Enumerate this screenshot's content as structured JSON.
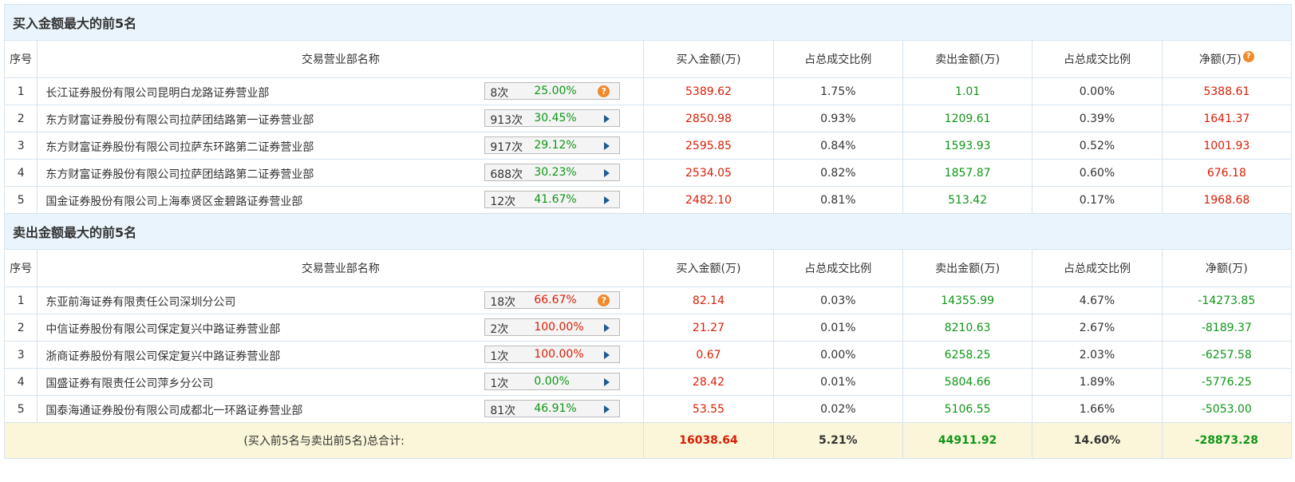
{
  "buy_section": {
    "title": "买入金额最大的前5名",
    "headers": [
      "序号",
      "交易营业部名称",
      "买入金额(万)",
      "占总成交比例",
      "卖出金额(万)",
      "占总成交比例",
      "净额(万)"
    ],
    "rows": [
      {
        "idx": "1",
        "name": "长江证券股份有限公司昆明白龙路证券营业部",
        "count": "8次",
        "pct": "25.00%",
        "pct_color": "green",
        "icon": "question-icon",
        "buy": "5389.62",
        "buy_ratio": "1.75%",
        "sell": "1.01",
        "sell_ratio": "0.00%",
        "net": "5388.61",
        "net_color": "red"
      },
      {
        "idx": "2",
        "name": "东方财富证券股份有限公司拉萨团结路第一证券营业部",
        "count": "913次",
        "pct": "30.45%",
        "pct_color": "green",
        "icon": "arrow-right-icon",
        "buy": "2850.98",
        "buy_ratio": "0.93%",
        "sell": "1209.61",
        "sell_ratio": "0.39%",
        "net": "1641.37",
        "net_color": "red"
      },
      {
        "idx": "3",
        "name": "东方财富证券股份有限公司拉萨东环路第二证券营业部",
        "count": "917次",
        "pct": "29.12%",
        "pct_color": "green",
        "icon": "arrow-right-icon",
        "buy": "2595.85",
        "buy_ratio": "0.84%",
        "sell": "1593.93",
        "sell_ratio": "0.52%",
        "net": "1001.93",
        "net_color": "red"
      },
      {
        "idx": "4",
        "name": "东方财富证券股份有限公司拉萨团结路第二证券营业部",
        "count": "688次",
        "pct": "30.23%",
        "pct_color": "green",
        "icon": "arrow-right-icon",
        "buy": "2534.05",
        "buy_ratio": "0.82%",
        "sell": "1857.87",
        "sell_ratio": "0.60%",
        "net": "676.18",
        "net_color": "red"
      },
      {
        "idx": "5",
        "name": "国金证券股份有限公司上海奉贤区金碧路证券营业部",
        "count": "12次",
        "pct": "41.67%",
        "pct_color": "green",
        "icon": "arrow-right-icon",
        "buy": "2482.10",
        "buy_ratio": "0.81%",
        "sell": "513.42",
        "sell_ratio": "0.17%",
        "net": "1968.68",
        "net_color": "red"
      }
    ]
  },
  "sell_section": {
    "title": "卖出金额最大的前5名",
    "headers": [
      "序号",
      "交易营业部名称",
      "买入金额(万)",
      "占总成交比例",
      "卖出金额(万)",
      "占总成交比例",
      "净额(万)"
    ],
    "rows": [
      {
        "idx": "1",
        "name": "东亚前海证券有限责任公司深圳分公司",
        "count": "18次",
        "pct": "66.67%",
        "pct_color": "red",
        "icon": "question-icon",
        "buy": "82.14",
        "buy_ratio": "0.03%",
        "sell": "14355.99",
        "sell_ratio": "4.67%",
        "net": "-14273.85",
        "net_color": "green"
      },
      {
        "idx": "2",
        "name": "中信证券股份有限公司保定复兴中路证券营业部",
        "count": "2次",
        "pct": "100.00%",
        "pct_color": "red",
        "icon": "arrow-right-icon",
        "buy": "21.27",
        "buy_ratio": "0.01%",
        "sell": "8210.63",
        "sell_ratio": "2.67%",
        "net": "-8189.37",
        "net_color": "green"
      },
      {
        "idx": "3",
        "name": "浙商证券股份有限公司保定复兴中路证券营业部",
        "count": "1次",
        "pct": "100.00%",
        "pct_color": "red",
        "icon": "arrow-right-icon",
        "buy": "0.67",
        "buy_ratio": "0.00%",
        "sell": "6258.25",
        "sell_ratio": "2.03%",
        "net": "-6257.58",
        "net_color": "green"
      },
      {
        "idx": "4",
        "name": "国盛证券有限责任公司萍乡分公司",
        "count": "1次",
        "pct": "0.00%",
        "pct_color": "green",
        "icon": "arrow-right-icon",
        "buy": "28.42",
        "buy_ratio": "0.01%",
        "sell": "5804.66",
        "sell_ratio": "1.89%",
        "net": "-5776.25",
        "net_color": "green"
      },
      {
        "idx": "5",
        "name": "国泰海通证券股份有限公司成都北一环路证券营业部",
        "count": "81次",
        "pct": "46.91%",
        "pct_color": "green",
        "icon": "arrow-right-icon",
        "buy": "53.55",
        "buy_ratio": "0.02%",
        "sell": "5106.55",
        "sell_ratio": "1.66%",
        "net": "-5053.00",
        "net_color": "green"
      }
    ]
  },
  "total": {
    "label": "(买入前5名与卖出前5名)总合计:",
    "buy": "16038.64",
    "buy_ratio": "5.21%",
    "sell": "44911.92",
    "sell_ratio": "14.60%",
    "net": "-28873.28"
  },
  "colors": {
    "red": "#d81e06",
    "green": "#109618",
    "header_bg": "#eaf4fc",
    "total_bg": "#fbf6d9",
    "question_icon": "#f08a2b",
    "arrow": "#1f5a92"
  }
}
